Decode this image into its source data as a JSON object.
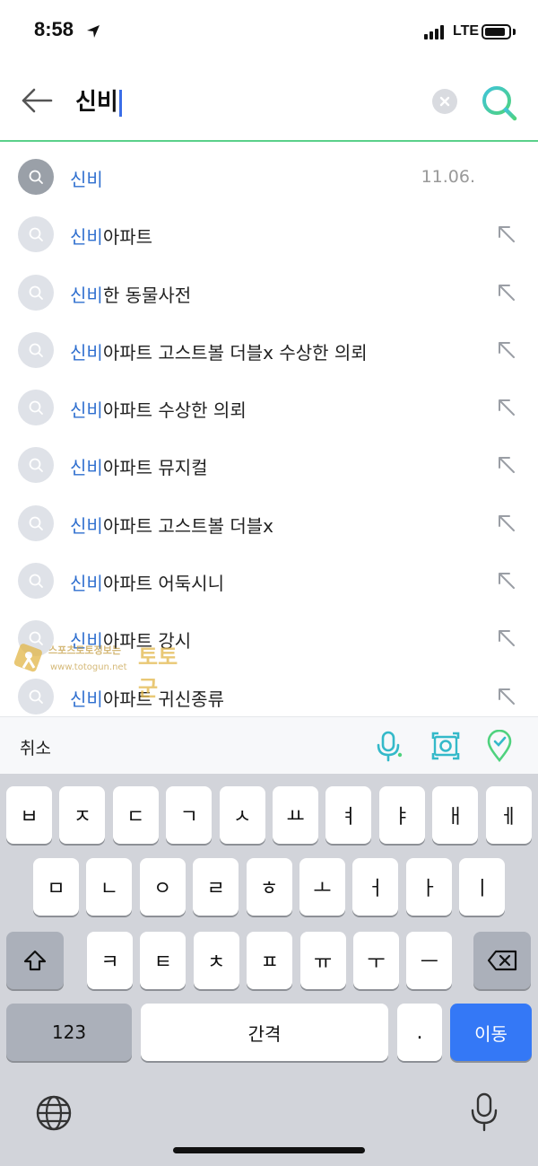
{
  "status_bar": {
    "time": "8:58",
    "network": "LTE"
  },
  "search": {
    "query": "신비",
    "icons": {
      "back": "back-arrow-icon",
      "clear": "clear-icon",
      "search": "search-icon"
    }
  },
  "suggestions": [
    {
      "highlight": "신비",
      "rest": "",
      "date": "11.06.",
      "recent": true
    },
    {
      "highlight": "신비",
      "rest": "아파트"
    },
    {
      "highlight": "신비",
      "rest": "한 동물사전"
    },
    {
      "highlight": "신비",
      "rest": "아파트 고스트볼 더블x 수상한 의뢰"
    },
    {
      "highlight": "신비",
      "rest": "아파트 수상한 의뢰"
    },
    {
      "highlight": "신비",
      "rest": "아파트 뮤지컬"
    },
    {
      "highlight": "신비",
      "rest": "아파트 고스트볼 더블x"
    },
    {
      "highlight": "신비",
      "rest": "아파트 어둑시니"
    },
    {
      "highlight": "신비",
      "rest": "아파트 강시"
    },
    {
      "highlight": "신비",
      "rest": "아파트 귀신종류"
    }
  ],
  "watermark": {
    "text": "스포츠토토정보는",
    "url": "www.totogun.net",
    "logo": "토토군"
  },
  "toolbar": {
    "cancel": "취소",
    "icons": [
      "microphone-icon",
      "camera-search-icon",
      "location-icon"
    ]
  },
  "keyboard": {
    "row1": [
      "ㅂ",
      "ㅈ",
      "ㄷ",
      "ㄱ",
      "ㅅ",
      "ㅛ",
      "ㅕ",
      "ㅑ",
      "ㅐ",
      "ㅔ"
    ],
    "row2": [
      "ㅁ",
      "ㄴ",
      "ㅇ",
      "ㄹ",
      "ㅎ",
      "ㅗ",
      "ㅓ",
      "ㅏ",
      "ㅣ"
    ],
    "row3": [
      "ㅋ",
      "ㅌ",
      "ㅊ",
      "ㅍ",
      "ㅠ",
      "ㅜ",
      "ㅡ"
    ],
    "numbers": "123",
    "space": "간격",
    "period": ".",
    "go": "이동",
    "colors": {
      "go_key": "#3478f6",
      "highlight": "#2f6fcf",
      "accent_green": "#5ad08a"
    }
  }
}
